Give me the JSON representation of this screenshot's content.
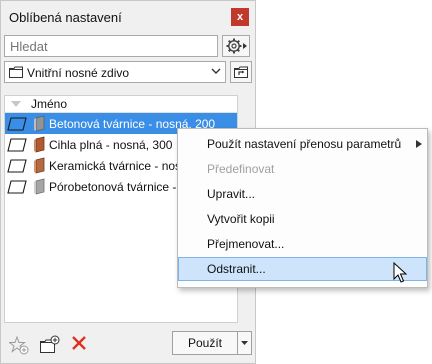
{
  "window": {
    "title": "Oblíbená nastavení",
    "close_label": "x"
  },
  "search": {
    "placeholder": "Hledat",
    "value": ""
  },
  "folder_combo": {
    "selected": "Vnitřní nosné zdivo"
  },
  "list": {
    "header": "Jméno",
    "items": [
      {
        "label": "Betonová tvárnice - nosná, 200",
        "selected": true,
        "brick_color": "#8e9499"
      },
      {
        "label": "Cihla plná - nosná, 300",
        "selected": false,
        "brick_color": "#b05a33"
      },
      {
        "label": "Keramická tvárnice - nosná",
        "selected": false,
        "brick_color": "#b56a42"
      },
      {
        "label": "Pórobetonová tvárnice -",
        "selected": false,
        "brick_color": "#a6a6a6"
      }
    ]
  },
  "bottom": {
    "apply_label": "Použít"
  },
  "context_menu": {
    "items": [
      {
        "label": "Použít nastavení přenosu parametrů",
        "enabled": true,
        "has_submenu": true
      },
      {
        "label": "Předefinovat",
        "enabled": false
      },
      {
        "label": "Upravit...",
        "enabled": true
      },
      {
        "label": "Vytvořit kopii",
        "enabled": true
      },
      {
        "label": "Přejmenovat...",
        "enabled": true
      },
      {
        "label": "Odstranit...",
        "enabled": true,
        "hovered": true
      }
    ]
  },
  "colors": {
    "selection": "#3a8ee6",
    "close_button": "#c0392b",
    "menu_hover": "#cde4fb",
    "delete_red": "#e03020"
  }
}
